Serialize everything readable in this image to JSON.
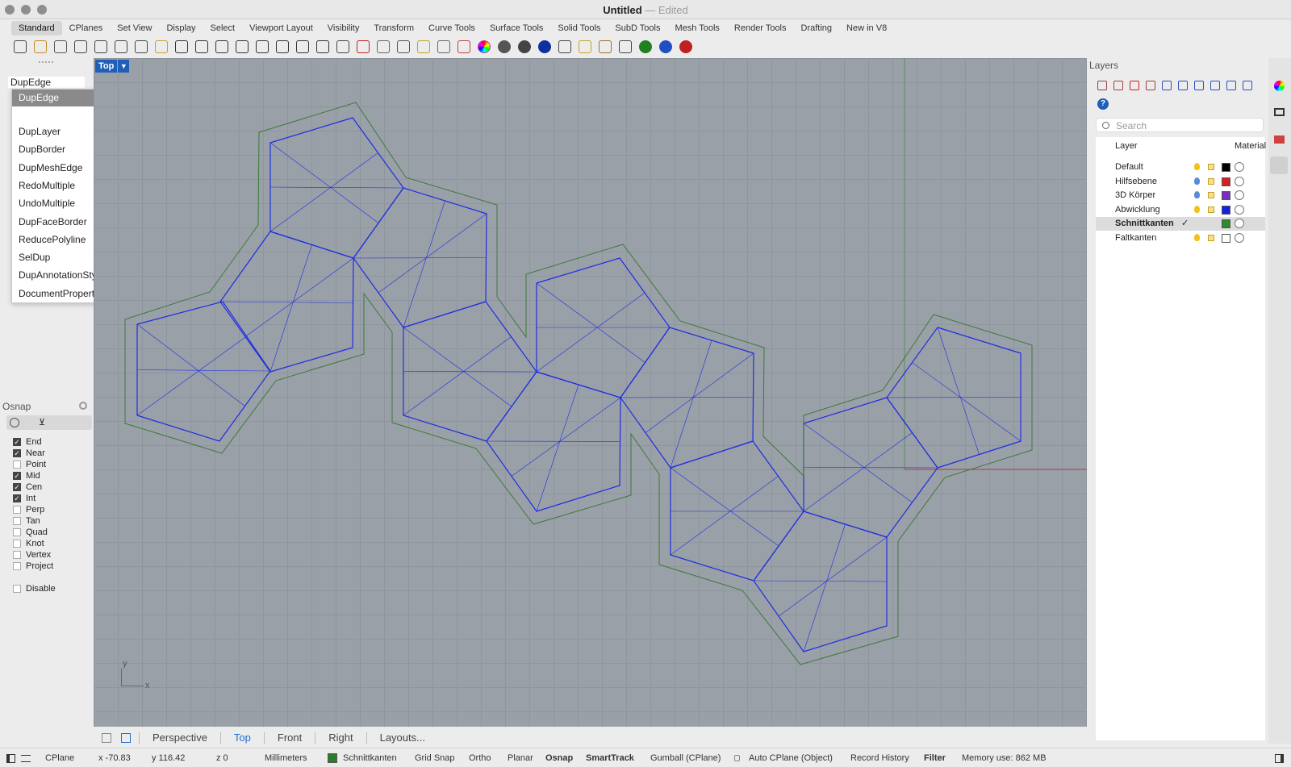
{
  "window": {
    "title": "Untitled",
    "separator": " — ",
    "status": "Edited"
  },
  "tabs": [
    "Standard",
    "CPlanes",
    "Set View",
    "Display",
    "Select",
    "Viewport Layout",
    "Visibility",
    "Transform",
    "Curve Tools",
    "Surface Tools",
    "Solid Tools",
    "SubD Tools",
    "Mesh Tools",
    "Render Tools",
    "Drafting",
    "New in V8"
  ],
  "active_tab": "Standard",
  "command": {
    "input_value": "DupEdge"
  },
  "autocomplete": {
    "selected": "DupEdge",
    "items": [
      "DupLayer",
      "DupBorder",
      "DupMeshEdge",
      "RedoMultiple",
      "UndoMultiple",
      "DupFaceBorder",
      "ReducePolyline",
      "SelDup",
      "DupAnnotationStyle",
      "DocumentProperties"
    ]
  },
  "osnap": {
    "title": "Osnap",
    "items": [
      {
        "label": "End",
        "checked": true
      },
      {
        "label": "Near",
        "checked": true
      },
      {
        "label": "Point",
        "checked": false
      },
      {
        "label": "Mid",
        "checked": true
      },
      {
        "label": "Cen",
        "checked": true
      },
      {
        "label": "Int",
        "checked": true
      },
      {
        "label": "Perp",
        "checked": false
      },
      {
        "label": "Tan",
        "checked": false
      },
      {
        "label": "Quad",
        "checked": false
      },
      {
        "label": "Knot",
        "checked": false
      },
      {
        "label": "Vertex",
        "checked": false
      },
      {
        "label": "Project",
        "checked": false
      }
    ],
    "disable": {
      "label": "Disable",
      "checked": false
    }
  },
  "viewport": {
    "name": "Top",
    "axis_y": "y",
    "axis_x": "x"
  },
  "viewport_tabs": [
    "Perspective",
    "Top",
    "Front",
    "Right",
    "Layouts..."
  ],
  "active_viewport_tab": "Top",
  "layers_panel": {
    "title": "Layers",
    "search_placeholder": "Search",
    "col_layer": "Layer",
    "col_material": "Material",
    "layers": [
      {
        "name": "Default",
        "color": "#000000",
        "current": false
      },
      {
        "name": "Hilfsebene",
        "color": "#d42020",
        "current": false
      },
      {
        "name": "3D Körper",
        "color": "#7a2fc0",
        "current": false
      },
      {
        "name": "Abwicklung",
        "color": "#1620e0",
        "current": false
      },
      {
        "name": "Schnittkanten",
        "color": "#2e8a2e",
        "current": true
      },
      {
        "name": "Faltkanten",
        "color": "#ffffff",
        "current": false
      }
    ]
  },
  "statusbar": {
    "cplane": "CPlane",
    "x": "x -70.83",
    "y": "y 116.42",
    "z": "z 0",
    "units": "Millimeters",
    "layer": "Schnittkanten",
    "layer_color": "#2e7a2e",
    "grid_snap": "Grid Snap",
    "ortho": "Ortho",
    "planar": "Planar",
    "osnap": "Osnap",
    "smarttrack": "SmartTrack",
    "gumball": "Gumball (CPlane)",
    "auto_cplane": "Auto CPlane (Object)",
    "record_history": "Record History",
    "filter": "Filter",
    "memory": "Memory use: 862 MB"
  },
  "colors": {
    "accent": "#1f5fb8",
    "curve_blue": "#1e2fe0",
    "curve_green": "#3b7a3b",
    "viewport_bg": "#9aa0a8"
  },
  "icons": [
    "new-icon",
    "open-icon",
    "save-icon",
    "print-icon",
    "import-icon",
    "cut-icon",
    "copy-icon",
    "paste-icon",
    "undo-icon",
    "pan-icon",
    "rotate-view-icon",
    "zoom-icon",
    "zoom-window-icon",
    "zoom-extents-icon",
    "zoom-selected-icon",
    "rotate-icon",
    "four-views-icon",
    "car-icon",
    "grid-icon",
    "cplane-icon",
    "light-icon",
    "lock-icon",
    "layer-icon",
    "color-wheel-icon",
    "shade-icon",
    "render-icon",
    "sphere-icon",
    "material-icon",
    "options-icon",
    "gear-icon",
    "dimension-icon",
    "globe-icon",
    "help-icon",
    "quit-icon"
  ]
}
